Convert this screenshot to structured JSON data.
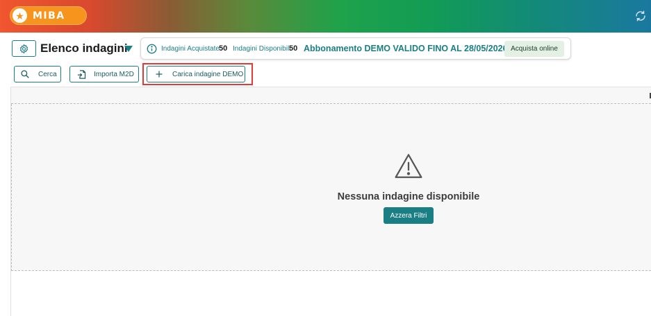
{
  "app": {
    "name": "MIBA"
  },
  "header": {
    "title": "Elenco indagini"
  },
  "stats": {
    "acquired_label": "Indagini Acquistate",
    "acquired_value": "50",
    "available_label": "Indagini Disponibili",
    "available_value": "50",
    "subscription": "Abbonamento DEMO VALIDO FINO AL 28/05/2026",
    "buy_label": "Acquista online"
  },
  "toolbar": {
    "search_label": "Cerca",
    "import_label": "Importa M2D",
    "load_demo_label": "Carica indagine DEMO"
  },
  "empty_state": {
    "message": "Nessuna indagine disponibile",
    "reset_label": "Azzera Filtri"
  },
  "colors": {
    "accent": "#1a7e85",
    "logo": "#f7941d",
    "highlight": "#e53935"
  },
  "icons": [
    "star-icon",
    "refresh-icon",
    "gear-icon",
    "caret-down-icon",
    "info-icon",
    "search-icon",
    "import-file-icon",
    "plus-icon",
    "warning-icon"
  ]
}
